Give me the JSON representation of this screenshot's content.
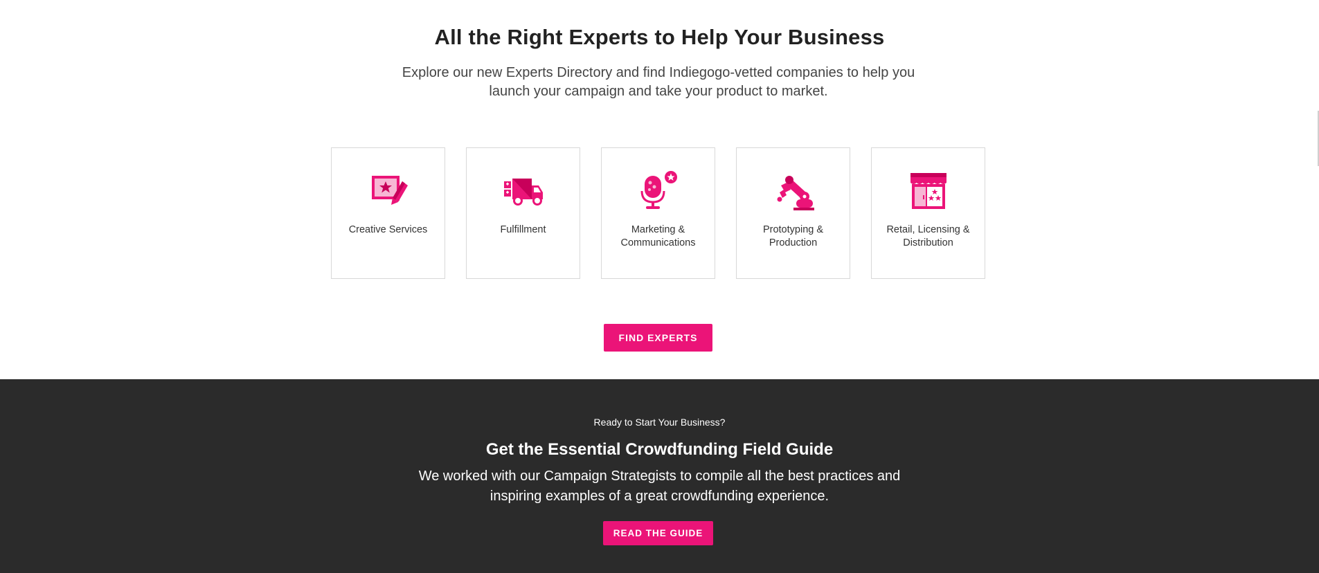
{
  "experts": {
    "title": "All the Right Experts to Help Your Business",
    "description": "Explore our new Experts Directory and find Indiegogo-vetted companies to help you launch your campaign and take your product to market.",
    "categories": [
      {
        "label": "Creative Services",
        "icon": "creative-services-icon"
      },
      {
        "label": "Fulfillment",
        "icon": "delivery-truck-icon"
      },
      {
        "label": "Marketing & Communications",
        "icon": "microphone-icon"
      },
      {
        "label": "Prototyping & Production",
        "icon": "robotic-arm-icon"
      },
      {
        "label": "Retail, Licensing & Distribution",
        "icon": "storefront-icon"
      }
    ],
    "cta_label": "FIND EXPERTS"
  },
  "guide": {
    "kicker": "Ready to Start Your Business?",
    "title": "Get the Essential Crowdfunding Field Guide",
    "description": "We worked with our Campaign Strategists to compile all the best practices and inspiring examples of a great crowdfunding experience.",
    "cta_label": "READ THE GUIDE"
  },
  "colors": {
    "accent": "#eb1478",
    "dark_section": "#2b2b2b",
    "card_border": "#d8d8d8"
  }
}
